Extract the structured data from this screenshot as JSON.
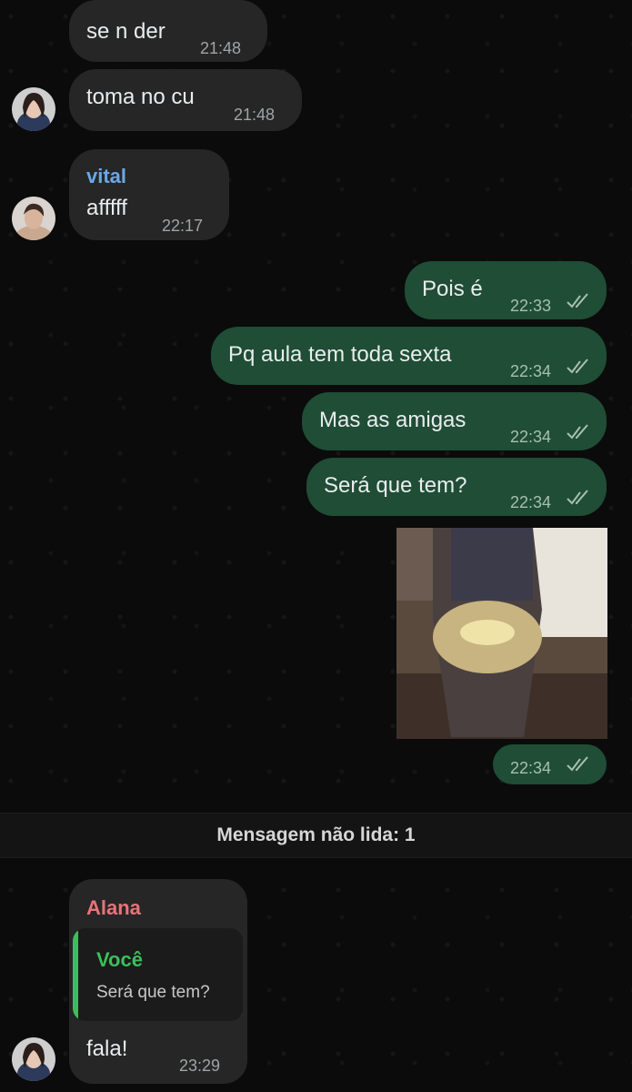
{
  "messages": [
    {
      "text": "se n der",
      "time": "21:48"
    },
    {
      "text": "toma no cu",
      "time": "21:48"
    },
    {
      "sender": "vital",
      "text": "afffff",
      "time": "22:17"
    },
    {
      "text": "Pois é",
      "time": "22:33"
    },
    {
      "text": "Pq aula tem toda sexta",
      "time": "22:34"
    },
    {
      "text": "Mas as amigas",
      "time": "22:34"
    },
    {
      "text": "Será que tem?",
      "time": "22:34"
    },
    {
      "time": "22:34"
    },
    {
      "sender": "Alana",
      "reply_author": "Você",
      "reply_text": "Será que tem?",
      "text": "fala!",
      "time": "23:29"
    }
  ],
  "unread_divider": "Mensagem não lida: 1",
  "colors": {
    "outgoing_bubble": "#1f4d35",
    "incoming_bubble": "#262626",
    "vital_name": "#6aa8e8",
    "alana_name": "#e8737a",
    "quote_accent": "#3bbf5c"
  },
  "icons": [
    "double-check-icon"
  ]
}
